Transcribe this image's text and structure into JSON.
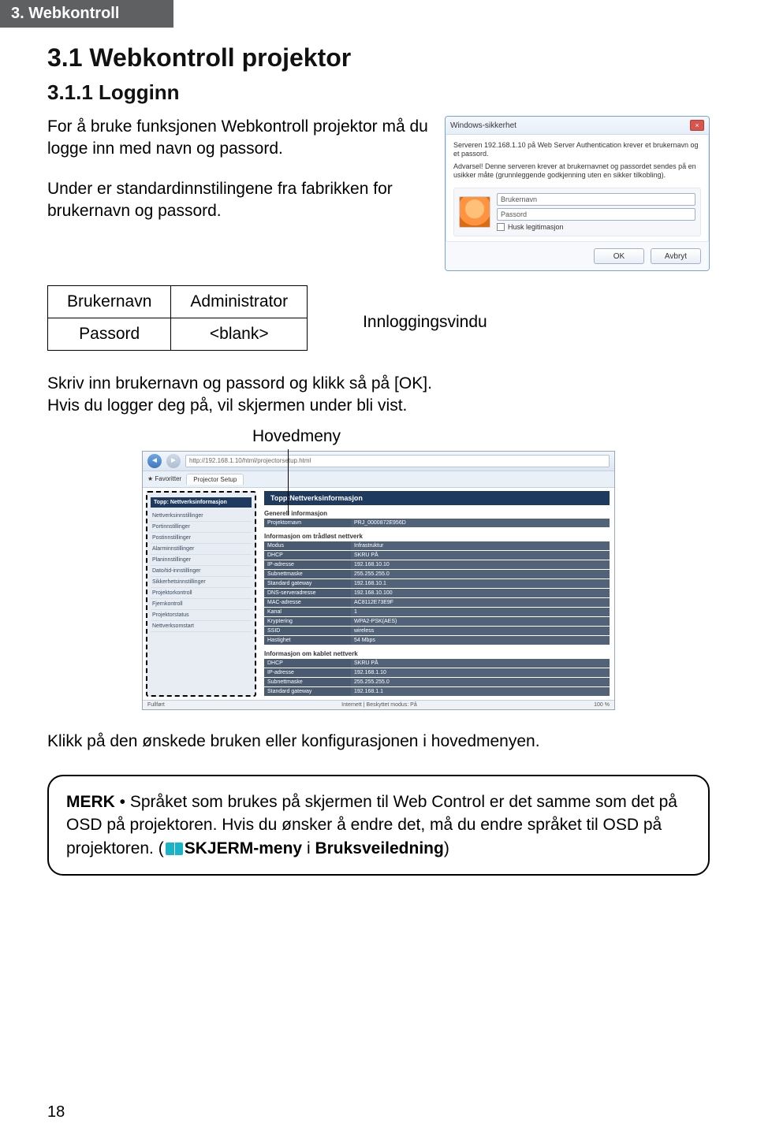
{
  "header_tag": "3. Webkontroll",
  "h1": "3.1 Webkontroll projektor",
  "h2": "3.1.1 Logginn",
  "intro1": "For å bruke funksjonen Webkontroll projektor må du logge inn med navn og passord.",
  "intro2": "Under er standardinnstilingene fra fabrikken for brukernavn og passord.",
  "cred": {
    "user_label": "Brukernavn",
    "user_value": "Administrator",
    "pass_label": "Passord",
    "pass_value": "<blank>"
  },
  "login_caption": "Innloggingsvindu",
  "login_dialog": {
    "title": "Windows-sikkerhet",
    "line1": "Serveren 192.168.1.10 på Web Server Authentication krever et brukernavn og et passord.",
    "line2": "Advarsel! Denne serveren krever at brukernavnet og passordet sendes på en usikker måte (grunnleggende godkjenning uten en sikker tilkobling).",
    "user_ph": "Brukernavn",
    "pass_ph": "Passord",
    "remember": "Husk legitimasjon",
    "ok": "OK",
    "cancel": "Avbryt"
  },
  "after_login1": "Skriv inn brukernavn og passord og klikk så på [OK].",
  "after_login2": "Hvis du logger deg på, vil skjermen under bli vist.",
  "hov_label": "Hovedmeny",
  "browser": {
    "url": "http://192.168.1.10/html/projectorsetup.html",
    "tab": "Projector Setup",
    "fullfort": "Fullført",
    "internet_status": "Internett | Beskyttet modus: På",
    "zoom": "100 %",
    "banner": "Topp:Nettverksinformasjon",
    "side_header": "Topp: Nettverksinformasjon",
    "side_items": [
      "Nettverksinnstillinger",
      "Portinnstillinger",
      "Postinnstillinger",
      "Alarminnstillinger",
      "Planinnstillinger",
      "Dato/tid-innstillinger",
      "Sikkerhetsinnstillinger",
      "Projektorkontroll",
      "Fjernkontroll",
      "Projektorstatus",
      "Nettverksomstart"
    ],
    "sec_general": "Generell informasjon",
    "general": [
      [
        "Projektornavn",
        "PRJ_0000872E956D"
      ]
    ],
    "sec_wifi": "Informasjon om trådløst nettverk",
    "wifi": [
      [
        "Modus",
        "Infrastruktur"
      ],
      [
        "DHCP",
        "SKRU PÅ"
      ],
      [
        "IP-adresse",
        "192.168.10.10"
      ],
      [
        "Subnettmaske",
        "255.255.255.0"
      ],
      [
        "Standard gateway",
        "192.168.10.1"
      ],
      [
        "DNS-serveradresse",
        "192.168.10.100"
      ],
      [
        "MAC-adresse",
        "AC8112E73E9F"
      ],
      [
        "Kanal",
        "1"
      ],
      [
        "Kryptering",
        "WPA2-PSK(AES)"
      ],
      [
        "SSID",
        "wireless"
      ],
      [
        "Hastighet",
        "54 Mbps"
      ]
    ],
    "sec_wired": "Informasjon om kablet nettverk",
    "wired": [
      [
        "DHCP",
        "SKRU PÅ"
      ],
      [
        "IP-adresse",
        "192.168.1.10"
      ],
      [
        "Subnettmaske",
        "255.255.255.0"
      ],
      [
        "Standard gateway",
        "192.168.1.1"
      ]
    ]
  },
  "click_text": "Klikk på den ønskede bruken eller konfigurasjonen i hovedmenyen.",
  "note": {
    "merk": "MERK",
    "body1": " • Språket som brukes på skjermen til Web Control er det samme som det på OSD på projektoren. Hvis du ønsker å endre det, må du endre språket til OSD på projektoren. (",
    "ref": "SKJERM-meny",
    "body2": " i ",
    "ref2": "Bruksveiledning",
    "body3": ")"
  },
  "page_num": "18"
}
